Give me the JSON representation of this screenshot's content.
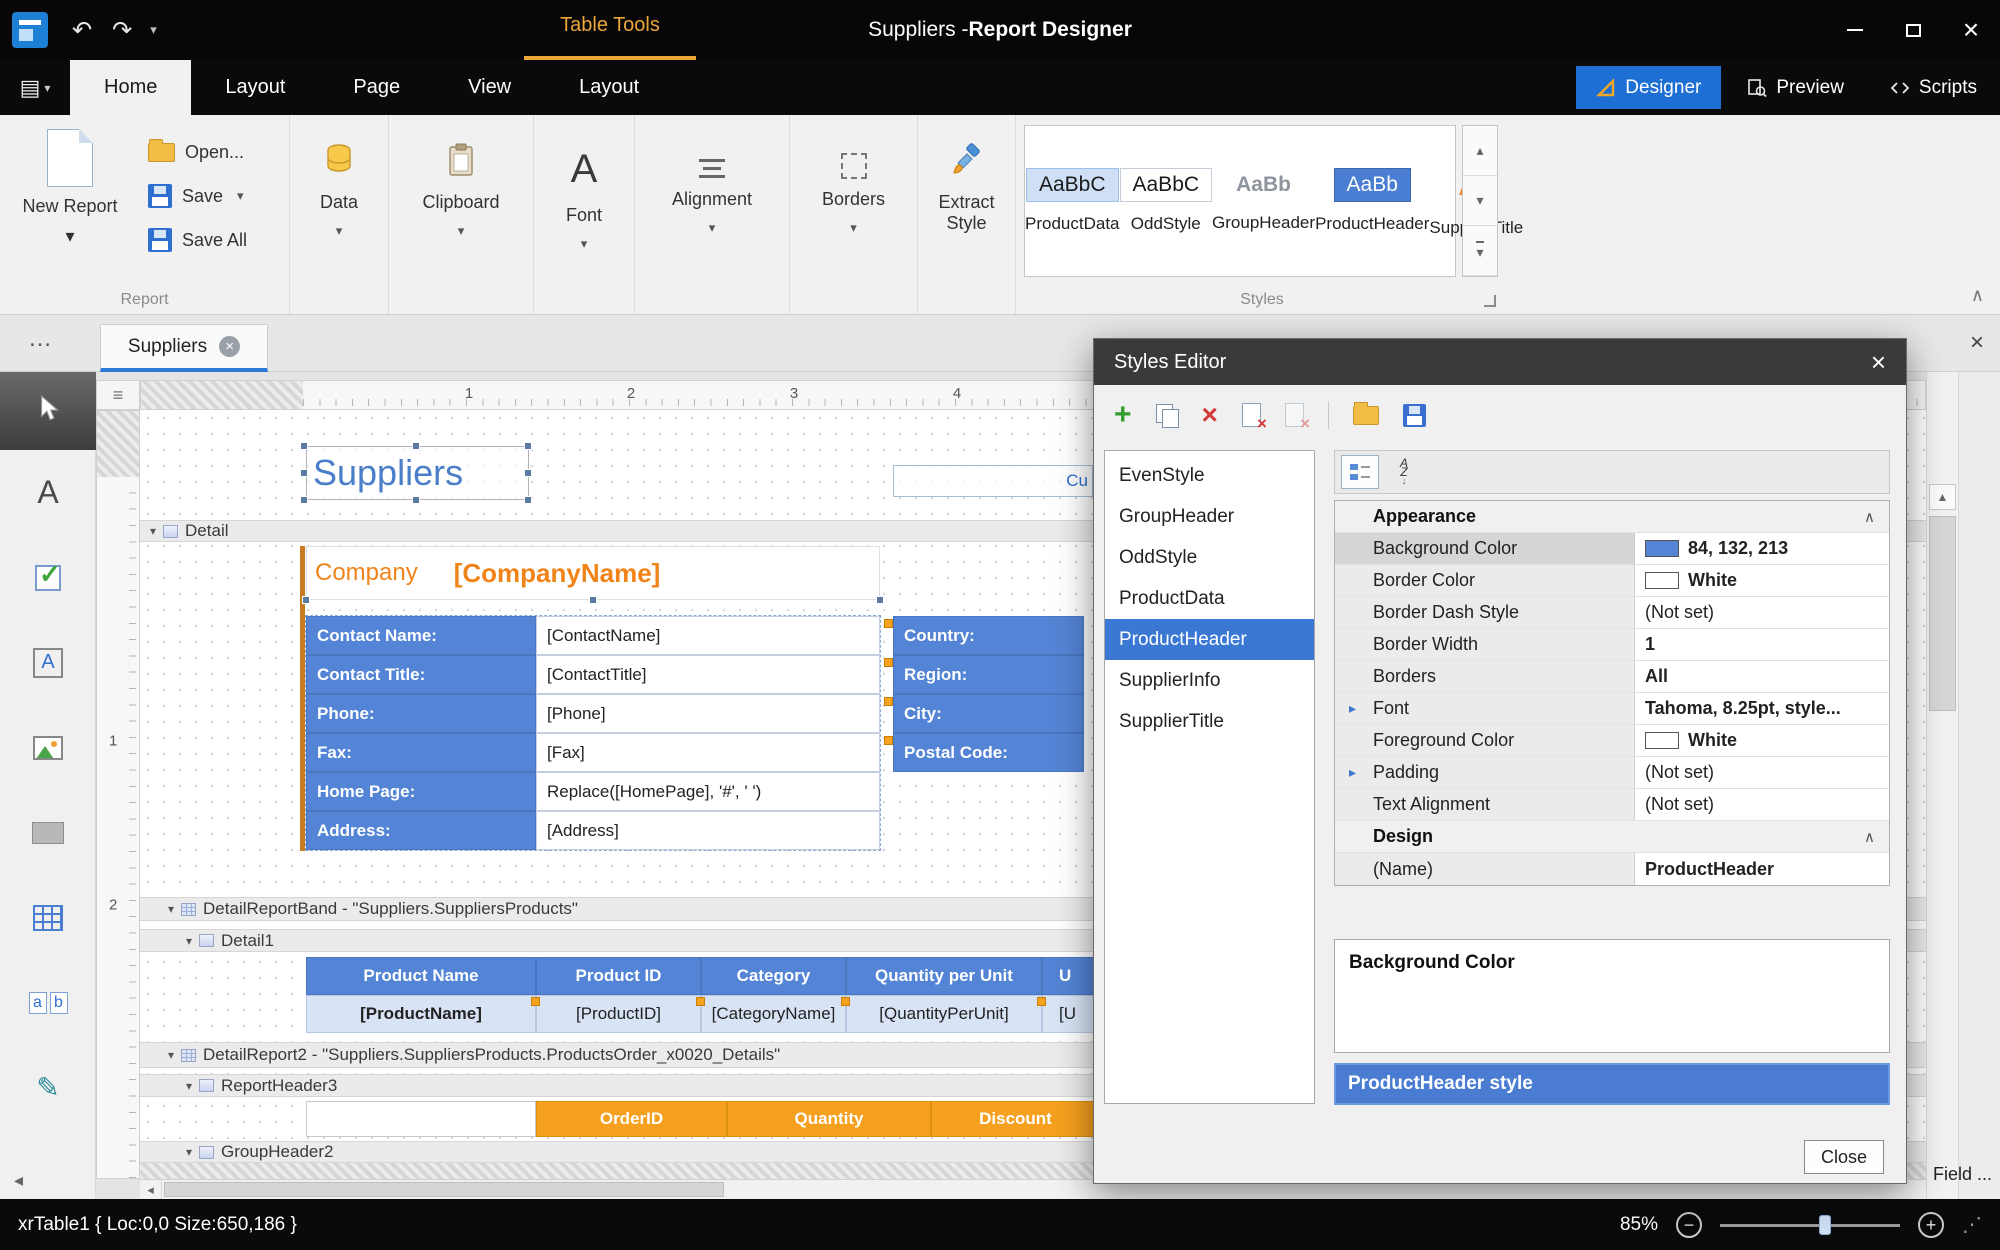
{
  "icons": {
    "undo": "↶",
    "redo": "↷",
    "caret_down": "▾",
    "caret_up": "▴",
    "hamburger": "▤",
    "close": "×",
    "tab_close": "×",
    "doc_close": "×",
    "ellipsis": "…",
    "chevron_up": "∧",
    "expand_right": "▸",
    "scroll_up": "▲",
    "scroll_left": "◂",
    "band_collapse": "▾",
    "add": "+",
    "delete": "×",
    "check": "✓",
    "tool_label": "A",
    "tool_richtext": "A",
    "tool_char_a": "a",
    "tool_char_b": "b",
    "pen": "✎",
    "font_icon": "A",
    "corner_rows": "≡",
    "letter_A": "A",
    "letter_Z": "Z",
    "arrow_down": "↓",
    "zoom_out": "−",
    "zoom_in": "+",
    "grip": "⋰"
  },
  "titlebar": {
    "context_tab": "Table Tools",
    "title_regular": "Suppliers - ",
    "title_bold": "Report Designer"
  },
  "ribbon": {
    "tabs": [
      "Home",
      "Layout",
      "Page",
      "View"
    ],
    "contextual_tab": "Layout",
    "view_buttons": [
      "Designer",
      "Preview",
      "Scripts"
    ],
    "report_group": {
      "label": "Report",
      "new_report": "New Report",
      "open": "Open...",
      "save": "Save",
      "save_all": "Save All"
    },
    "dropdown_buttons": [
      "Data",
      "Clipboard",
      "Font",
      "Alignment",
      "Borders"
    ],
    "extract_style": "Extract Style",
    "styles_group": {
      "label": "Styles",
      "gallery": [
        {
          "sample": "AaBbC",
          "name": "ProductData"
        },
        {
          "sample": "AaBbC",
          "name": "OddStyle"
        },
        {
          "sample": "AaBb",
          "name": "GroupHeader"
        },
        {
          "sample": "AaBb",
          "name": "ProductHeader"
        },
        {
          "sample": "Aa",
          "name": "SupplierTitle"
        }
      ]
    }
  },
  "document_tabs": {
    "active": "Suppliers"
  },
  "designer": {
    "ruler_h": [
      "1",
      "2",
      "3",
      "4"
    ],
    "ruler_v": [
      "1",
      "2"
    ],
    "report_title": "Suppliers",
    "clipped_field": "Cu",
    "bands": {
      "detail": "Detail",
      "detail_report": "DetailReportBand - \"Suppliers.SuppliersProducts\"",
      "detail1": "Detail1",
      "detail_report2": "DetailReport2 - \"Suppliers.SuppliersProducts.ProductsOrder_x0020_Details\"",
      "report_header3": "ReportHeader3",
      "group_header2": "GroupHeader2"
    },
    "company": {
      "label": "Company",
      "field": "[CompanyName]"
    },
    "supplier_table": {
      "rows": [
        {
          "label": "Contact Name:",
          "value": "[ContactName]"
        },
        {
          "label": "Contact Title:",
          "value": "[ContactTitle]"
        },
        {
          "label": "Phone:",
          "value": "[Phone]"
        },
        {
          "label": "Fax:",
          "value": "[Fax]"
        },
        {
          "label": "Home Page:",
          "value": "Replace([HomePage], '#', ' ')"
        },
        {
          "label": "Address:",
          "value": "[Address]"
        }
      ]
    },
    "region_labels": [
      "Country:",
      "Region:",
      "City:",
      "Postal Code:"
    ],
    "product_table": {
      "headers": [
        "Product Name",
        "Product ID",
        "Category",
        "Quantity per Unit",
        "U"
      ],
      "fields": [
        "[ProductName]",
        "[ProductID]",
        "[CategoryName]",
        "[QuantityPerUnit]",
        "[U"
      ]
    },
    "order_table": {
      "headers": [
        "OrderID",
        "Quantity",
        "Discount"
      ]
    }
  },
  "styles_editor": {
    "title": "Styles Editor",
    "styles": [
      "EvenStyle",
      "GroupHeader",
      "OddStyle",
      "ProductData",
      "ProductHeader",
      "SupplierInfo",
      "SupplierTitle"
    ],
    "selected_style": "ProductHeader",
    "sections": [
      {
        "name": "Appearance",
        "rows": [
          {
            "name": "Background Color",
            "value": "84, 132, 213",
            "swatch": "#5484d5"
          },
          {
            "name": "Border Color",
            "value": "White",
            "swatch": "#ffffff"
          },
          {
            "name": "Border Dash Style",
            "value": "(Not set)"
          },
          {
            "name": "Border Width",
            "value": "1"
          },
          {
            "name": "Borders",
            "value": "All"
          },
          {
            "name": "Font",
            "value": "Tahoma, 8.25pt, style..."
          },
          {
            "name": "Foreground Color",
            "value": "White",
            "swatch": "#ffffff"
          },
          {
            "name": "Padding",
            "value": "(Not set)"
          },
          {
            "name": "Text Alignment",
            "value": "(Not set)"
          }
        ]
      },
      {
        "name": "Design",
        "rows": [
          {
            "name": "(Name)",
            "value": "ProductHeader"
          }
        ]
      }
    ],
    "description_title": "Background Color",
    "preview_text": "ProductHeader style",
    "close_button": "Close"
  },
  "statusbar": {
    "selection_info": "xrTable1 { Loc:0,0 Size:650,186 }",
    "zoom_level": "85%"
  },
  "panels": {
    "field_list_tab": "Field ..."
  },
  "colors": {
    "accent_blue": "#5484d5",
    "header_orange": "#f5a01e",
    "title_blue": "#4a7ec8",
    "designer_button_blue": "#1e6fd4",
    "selected_item_blue": "#3a78d4",
    "context_tab_orange": "#eda63a",
    "doc_tab_underline": "#2b79d7"
  }
}
